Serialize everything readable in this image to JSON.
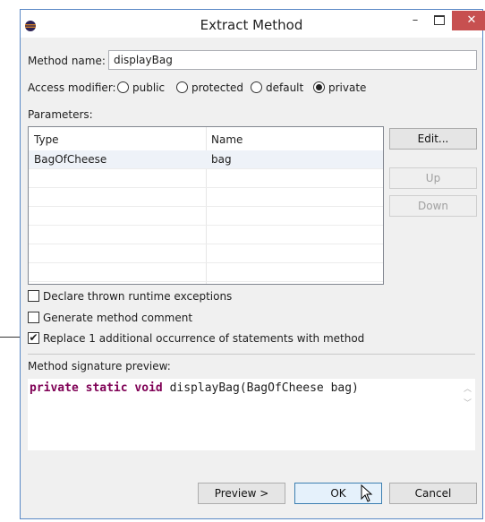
{
  "window": {
    "title": "Extract Method",
    "close_glyph": "✕",
    "minimize_glyph": "–"
  },
  "method_name": {
    "label": "Method name:",
    "value": "displayBag"
  },
  "access_modifier": {
    "label": "Access modifier:",
    "options": [
      "public",
      "protected",
      "default",
      "private"
    ],
    "selected": "private"
  },
  "parameters": {
    "label": "Parameters:",
    "columns": [
      "Type",
      "Name"
    ],
    "rows": [
      {
        "type": "BagOfCheese",
        "name": "bag"
      }
    ]
  },
  "buttons": {
    "edit": "Edit...",
    "up": "Up",
    "down": "Down",
    "preview": "Preview >",
    "ok": "OK",
    "cancel": "Cancel"
  },
  "options": {
    "declare_exceptions": {
      "label": "Declare thrown runtime exceptions",
      "checked": false
    },
    "generate_comment": {
      "label": "Generate method comment",
      "checked": false
    },
    "replace_occurrences": {
      "label": "Replace 1 additional occurrence of statements with method",
      "checked": true,
      "mark": "✔"
    }
  },
  "signature_preview": {
    "label": "Method signature preview:",
    "kw1": "private",
    "kw2": "static",
    "kw3": "void",
    "rest": "displayBag(BagOfCheese bag)"
  },
  "colors": {
    "keyword": "#7f0055",
    "close_button": "#c75050",
    "default_button_border": "#3c7fb1"
  }
}
